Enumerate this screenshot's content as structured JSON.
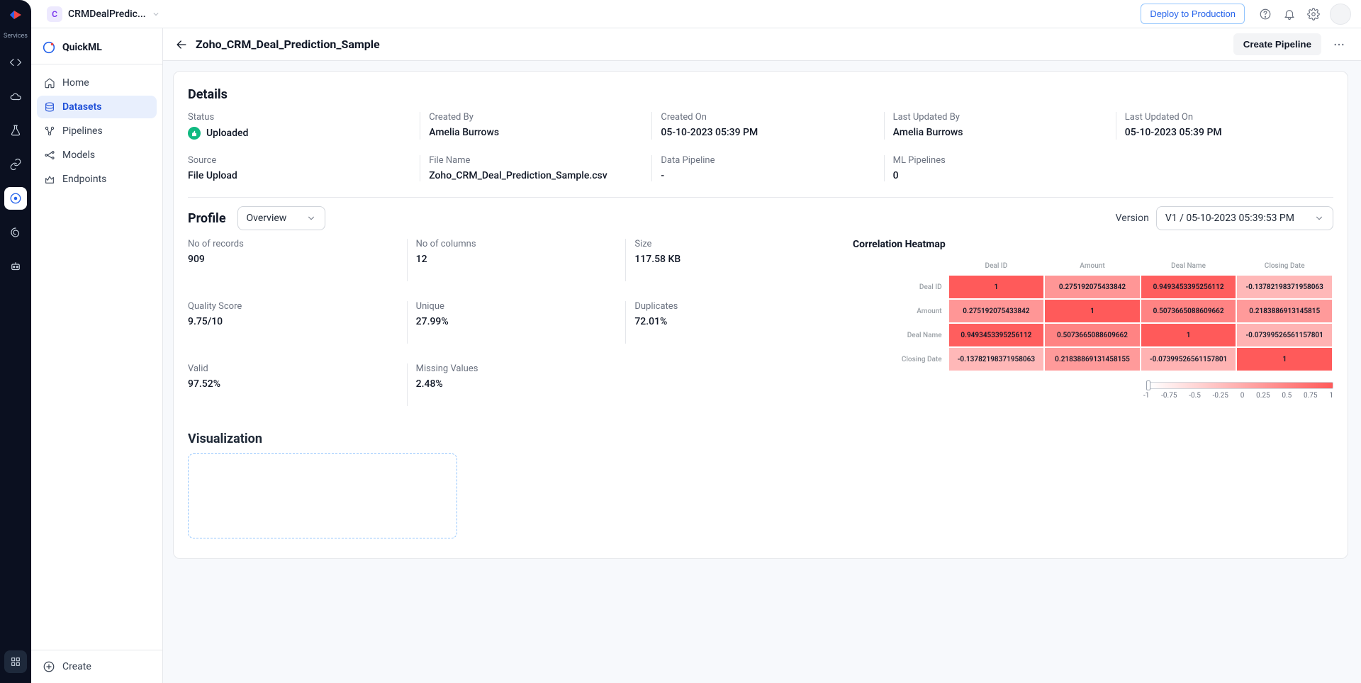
{
  "topbar": {
    "project_badge": "C",
    "project_name": "CRMDealPredic...",
    "deploy_label": "Deploy to Production"
  },
  "rail": {
    "services_label": "Services"
  },
  "sidebar": {
    "app_title": "QuickML",
    "items": [
      {
        "label": "Home",
        "icon": "home-icon"
      },
      {
        "label": "Datasets",
        "icon": "datasets-icon"
      },
      {
        "label": "Pipelines",
        "icon": "pipelines-icon"
      },
      {
        "label": "Models",
        "icon": "models-icon"
      },
      {
        "label": "Endpoints",
        "icon": "endpoints-icon"
      }
    ],
    "create_label": "Create"
  },
  "page": {
    "title": "Zoho_CRM_Deal_Prediction_Sample",
    "create_pipeline_label": "Create Pipeline"
  },
  "details": {
    "section_title": "Details",
    "status_label": "Status",
    "status_value": "Uploaded",
    "created_by_label": "Created By",
    "created_by_value": "Amelia Burrows",
    "created_on_label": "Created On",
    "created_on_value": "05-10-2023 05:39 PM",
    "updated_by_label": "Last Updated By",
    "updated_by_value": "Amelia Burrows",
    "updated_on_label": "Last Updated On",
    "updated_on_value": "05-10-2023 05:39 PM",
    "source_label": "Source",
    "source_value": "File Upload",
    "file_name_label": "File Name",
    "file_name_value": "Zoho_CRM_Deal_Prediction_Sample.csv",
    "data_pipeline_label": "Data Pipeline",
    "data_pipeline_value": "-",
    "ml_pipelines_label": "ML Pipelines",
    "ml_pipelines_value": "0"
  },
  "profile": {
    "section_title": "Profile",
    "overview_selected": "Overview",
    "version_label": "Version",
    "version_selected": "V1 / 05-10-2023 05:39:53 PM",
    "stats": {
      "records_label": "No of records",
      "records_value": "909",
      "columns_label": "No of columns",
      "columns_value": "12",
      "size_label": "Size",
      "size_value": "117.58 KB",
      "quality_label": "Quality Score",
      "quality_value": "9.75/10",
      "unique_label": "Unique",
      "unique_value": "27.99%",
      "duplicates_label": "Duplicates",
      "duplicates_value": "72.01%",
      "valid_label": "Valid",
      "valid_value": "97.52%",
      "missing_label": "Missing Values",
      "missing_value": "2.48%"
    }
  },
  "chart_data": {
    "type": "heatmap",
    "title": "Correlation Heatmap",
    "x_labels": [
      "Deal ID",
      "Amount",
      "Deal Name",
      "Closing Date"
    ],
    "y_labels": [
      "Deal ID",
      "Amount",
      "Deal Name",
      "Closing Date"
    ],
    "matrix": [
      [
        1,
        0.275192075433842,
        0.9493453395256112,
        -0.13782198371958063
      ],
      [
        0.275192075433842,
        1,
        0.5073665088609662,
        0.2183886913145815
      ],
      [
        0.9493453395256112,
        0.5073665088609662,
        1,
        -0.07399526561157801
      ],
      [
        -0.13782198371958063,
        0.21838869131458155,
        -0.07399526561157801,
        1
      ]
    ],
    "cell_text": [
      [
        "1",
        "0.275192075433842",
        "0.9493453395256112",
        "-0.13782198371958063"
      ],
      [
        "0.275192075433842",
        "1",
        "0.5073665088609662",
        "0.2183886913145815"
      ],
      [
        "0.9493453395256112",
        "0.5073665088609662",
        "1",
        "-0.07399526561157801"
      ],
      [
        "-0.13782198371958063",
        "0.21838869131458155",
        "-0.07399526561157801",
        "1"
      ]
    ],
    "color_scale": {
      "min": -1,
      "max": 1,
      "low": "#ffffff",
      "high": "#ff5a5a"
    },
    "legend_ticks": [
      "-1",
      "-0.75",
      "-0.5",
      "-0.25",
      "0",
      "0.25",
      "0.5",
      "0.75",
      "1"
    ]
  },
  "visualization": {
    "section_title": "Visualization"
  }
}
